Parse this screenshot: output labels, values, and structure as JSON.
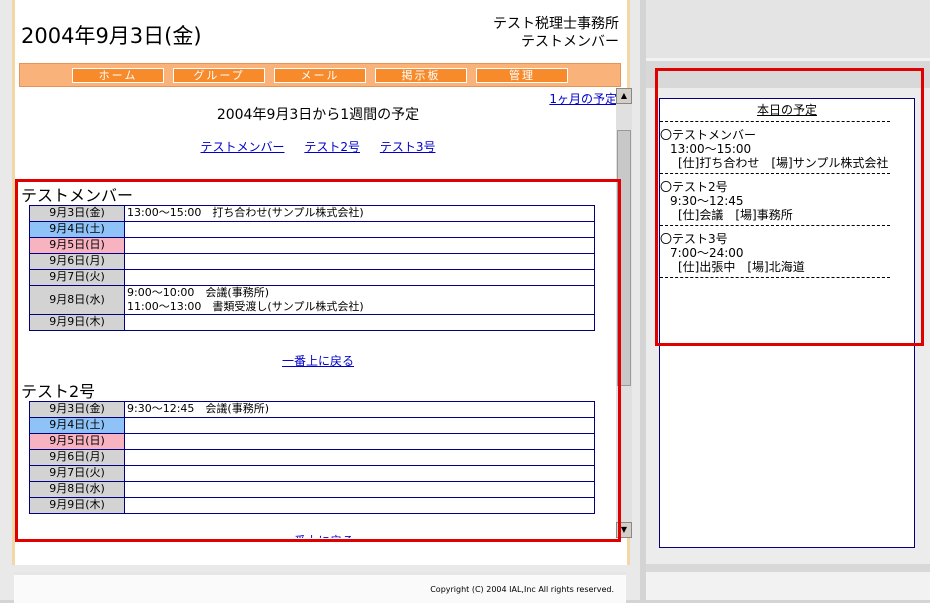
{
  "header": {
    "date": "2004年9月3日(金)",
    "office": "テスト税理士事務所",
    "member": "テストメンバー"
  },
  "nav": [
    "ホーム",
    "グループ",
    "メール",
    "掲示板",
    "管理"
  ],
  "main": {
    "month_link": "1ヶ月の予定",
    "week_title": "2004年9月3日から1週間の予定",
    "member_links": [
      "テストメンバー",
      "テスト2号",
      "テスト3号"
    ],
    "back_to_top": "一番上に戻る",
    "sections": [
      {
        "name": "テストメンバー",
        "rows": [
          {
            "day": "9月3日(金)",
            "type": "weekday",
            "entries": [
              "13:00～15:00　打ち合わせ(サンプル株式会社)"
            ]
          },
          {
            "day": "9月4日(土)",
            "type": "sat",
            "entries": []
          },
          {
            "day": "9月5日(日)",
            "type": "sun",
            "entries": []
          },
          {
            "day": "9月6日(月)",
            "type": "weekday",
            "entries": []
          },
          {
            "day": "9月7日(火)",
            "type": "weekday",
            "entries": []
          },
          {
            "day": "9月8日(水)",
            "type": "weekday",
            "entries": [
              "9:00～10:00　会議(事務所)",
              "11:00～13:00　書類受渡し(サンプル株式会社)"
            ]
          },
          {
            "day": "9月9日(木)",
            "type": "weekday",
            "entries": []
          }
        ]
      },
      {
        "name": "テスト2号",
        "rows": [
          {
            "day": "9月3日(金)",
            "type": "weekday",
            "entries": [
              "9:30～12:45　会議(事務所)"
            ]
          },
          {
            "day": "9月4日(土)",
            "type": "sat",
            "entries": []
          },
          {
            "day": "9月5日(日)",
            "type": "sun",
            "entries": []
          },
          {
            "day": "9月6日(月)",
            "type": "weekday",
            "entries": []
          },
          {
            "day": "9月7日(火)",
            "type": "weekday",
            "entries": []
          },
          {
            "day": "9月8日(水)",
            "type": "weekday",
            "entries": []
          },
          {
            "day": "9月9日(木)",
            "type": "weekday",
            "entries": []
          }
        ]
      }
    ]
  },
  "footer": {
    "copyright": "Copyright (C) 2004 IAL,Inc All rights reserved."
  },
  "today": {
    "title": "本日の予定",
    "entries": [
      {
        "name": "〇テストメンバー",
        "time": "13:00～15:00",
        "detail": "[仕]打ち合わせ　[場]サンプル株式会社"
      },
      {
        "name": "〇テスト2号",
        "time": "9:30～12:45",
        "detail": "[仕]会議　[場]事務所"
      },
      {
        "name": "〇テスト3号",
        "time": "7:00～24:00",
        "detail": "[仕]出張中　[場]北海道"
      }
    ]
  },
  "colors": {
    "nav_bg": "#f8b27a",
    "nav_button": "#f78a2a",
    "sat": "#8fc3f7",
    "sun": "#f7b3c0",
    "weekday": "#d3d3d3",
    "highlight": "#e00000",
    "link": "#0000cc"
  }
}
